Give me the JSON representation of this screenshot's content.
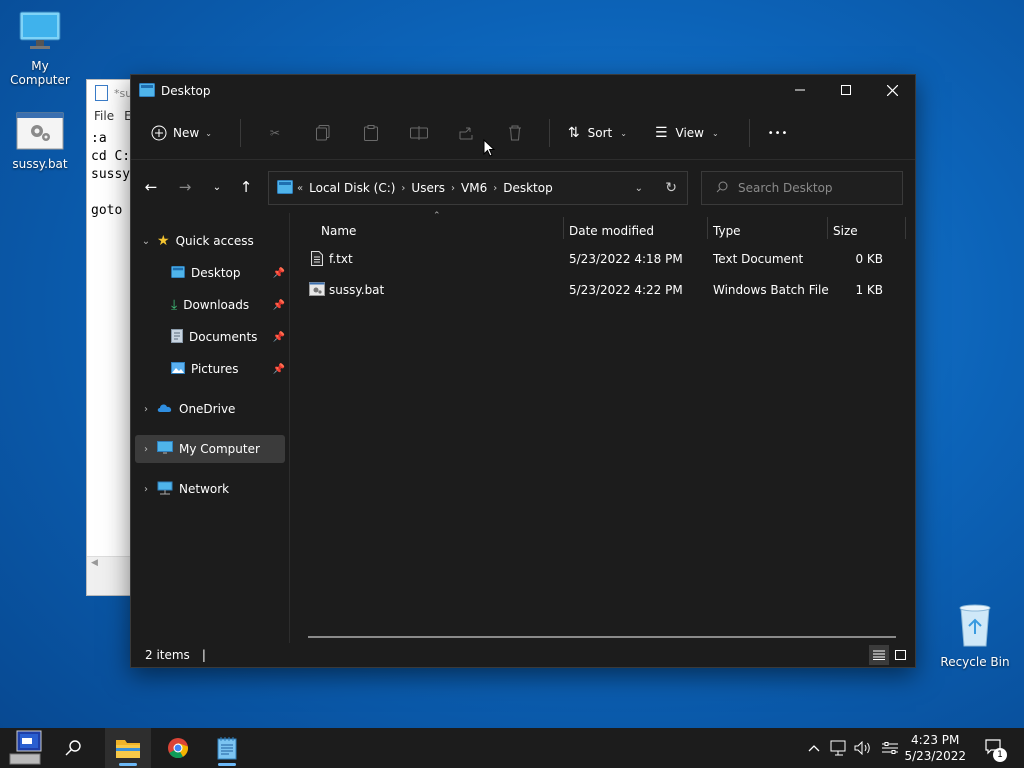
{
  "desktop": {
    "icons": [
      {
        "label": "My Computer"
      },
      {
        "label": "sussy.bat"
      },
      {
        "label": "Recycle Bin"
      }
    ]
  },
  "notepad": {
    "title": "*su",
    "menu": [
      "File",
      "E"
    ],
    "lines": [
      ":a",
      "cd C:",
      "sussy",
      "",
      "goto"
    ]
  },
  "explorer": {
    "title": "Desktop",
    "cmdbar": {
      "new": "New",
      "sort": "Sort",
      "view": "View",
      "more": "•••"
    },
    "breadcrumb": [
      "Local Disk (C:)",
      "Users",
      "VM6",
      "Desktop"
    ],
    "search_placeholder": "Search Desktop",
    "nav": {
      "quick_access": "Quick access",
      "desktop": "Desktop",
      "downloads": "Downloads",
      "documents": "Documents",
      "pictures": "Pictures",
      "onedrive": "OneDrive",
      "my_computer": "My Computer",
      "network": "Network"
    },
    "columns": {
      "name": "Name",
      "date": "Date modified",
      "type": "Type",
      "size": "Size"
    },
    "files": [
      {
        "name": "f.txt",
        "date": "5/23/2022 4:18 PM",
        "type": "Text Document",
        "size": "0 KB"
      },
      {
        "name": "sussy.bat",
        "date": "5/23/2022 4:22 PM",
        "type": "Windows Batch File",
        "size": "1 KB"
      }
    ],
    "status": "2 items"
  },
  "taskbar": {
    "time": "4:23 PM",
    "date": "5/23/2022",
    "notification_count": "1"
  }
}
